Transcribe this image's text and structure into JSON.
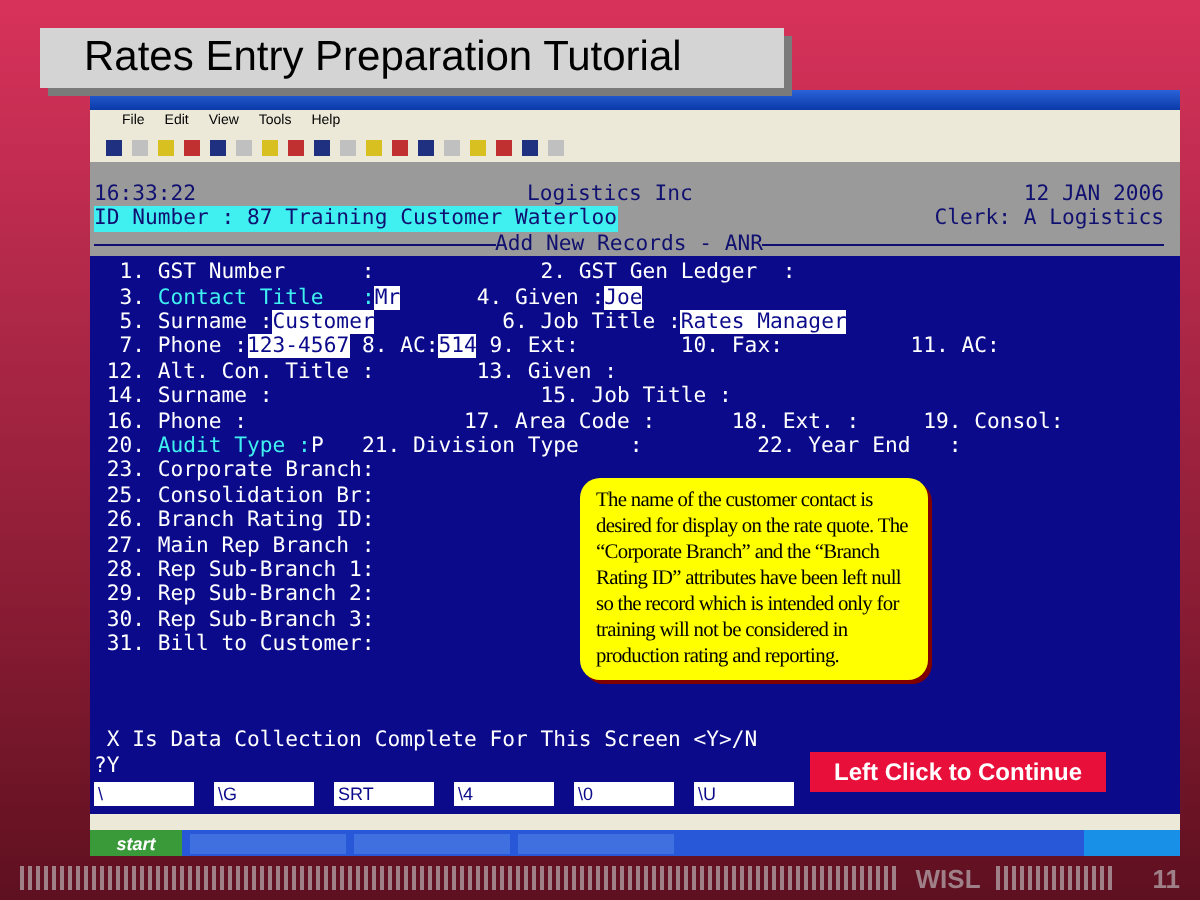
{
  "slide_title": "Rates Entry Preparation Tutorial",
  "menu": [
    "File",
    "Edit",
    "View",
    "Tools",
    "Help"
  ],
  "terminal": {
    "time": "16:33:22",
    "company": "Logistics Inc",
    "date": "12 JAN 2006",
    "id_line": "ID Number : 87 Training Customer Waterloo",
    "clerk": "Clerk: A Logistics",
    "screen_title": "Add New Records - ANR",
    "lines": [
      {
        "spans": [
          {
            "text": "  1. GST Number      :             2. GST Gen Ledger  :",
            "kind": "plain"
          }
        ]
      },
      {
        "spans": [
          {
            "text": "  3. ",
            "kind": "plain"
          },
          {
            "text": "Contact Title   :",
            "kind": "label"
          },
          {
            "text": "Mr",
            "kind": "value"
          },
          {
            "text": "      4. Given :",
            "kind": "plain"
          },
          {
            "text": "Joe",
            "kind": "value"
          }
        ]
      },
      {
        "spans": [
          {
            "text": "  5. Surname :",
            "kind": "plain"
          },
          {
            "text": "Customer",
            "kind": "value"
          },
          {
            "text": "          6. Job Title :",
            "kind": "plain"
          },
          {
            "text": "Rates Manager",
            "kind": "value"
          }
        ]
      },
      {
        "spans": [
          {
            "text": "  7. Phone :",
            "kind": "plain"
          },
          {
            "text": "123-4567",
            "kind": "value"
          },
          {
            "text": " 8. AC:",
            "kind": "plain"
          },
          {
            "text": "514",
            "kind": "value"
          },
          {
            "text": " 9. Ext:        10. Fax:          11. AC:",
            "kind": "plain"
          }
        ]
      },
      {
        "spans": [
          {
            "text": " 12. Alt. Con. Title :        13. Given :",
            "kind": "plain"
          }
        ]
      },
      {
        "spans": [
          {
            "text": " 14. Surname :                     15. Job Title :",
            "kind": "plain"
          }
        ]
      },
      {
        "spans": [
          {
            "text": " 16. Phone :                 17. Area Code :      18. Ext. :     19. Consol:",
            "kind": "plain"
          }
        ]
      },
      {
        "spans": [
          {
            "text": " 20. ",
            "kind": "plain"
          },
          {
            "text": "Audit Type :",
            "kind": "label"
          },
          {
            "text": "P   21. Division Type    :         22. Year End   :",
            "kind": "plain"
          }
        ]
      },
      {
        "spans": [
          {
            "text": " 23. Corporate Branch:",
            "kind": "plain"
          }
        ]
      },
      {
        "spans": [
          {
            "text": " 25. Consolidation Br:",
            "kind": "plain"
          }
        ]
      },
      {
        "spans": [
          {
            "text": " 26. Branch Rating ID:",
            "kind": "plain"
          }
        ]
      },
      {
        "spans": [
          {
            "text": " 27. Main Rep Branch :",
            "kind": "plain"
          }
        ]
      },
      {
        "spans": [
          {
            "text": " 28. Rep Sub-Branch 1:",
            "kind": "plain"
          }
        ]
      },
      {
        "spans": [
          {
            "text": " 29. Rep Sub-Branch 2:",
            "kind": "plain"
          }
        ]
      },
      {
        "spans": [
          {
            "text": " 30. Rep Sub-Branch 3:",
            "kind": "plain"
          }
        ]
      },
      {
        "spans": [
          {
            "text": " 31. Bill to Customer:",
            "kind": "plain"
          }
        ]
      }
    ],
    "prompt": " X Is Data Collection Complete For This Screen <Y>/N",
    "answer": "?Y",
    "fields": [
      "\\",
      "\\G",
      "SRT",
      "\\4",
      "\\0",
      "\\U"
    ]
  },
  "callout": "The name of the customer contact is desired for display on the rate quote. The “Corporate Branch” and the “Branch Rating ID” attributes have been left null so the record which is intended only for training will not be considered in production rating and reporting.",
  "continue_button": "Left Click to Continue",
  "taskbar": {
    "start": "start"
  },
  "footer": {
    "org": "WISL",
    "page": "11"
  }
}
